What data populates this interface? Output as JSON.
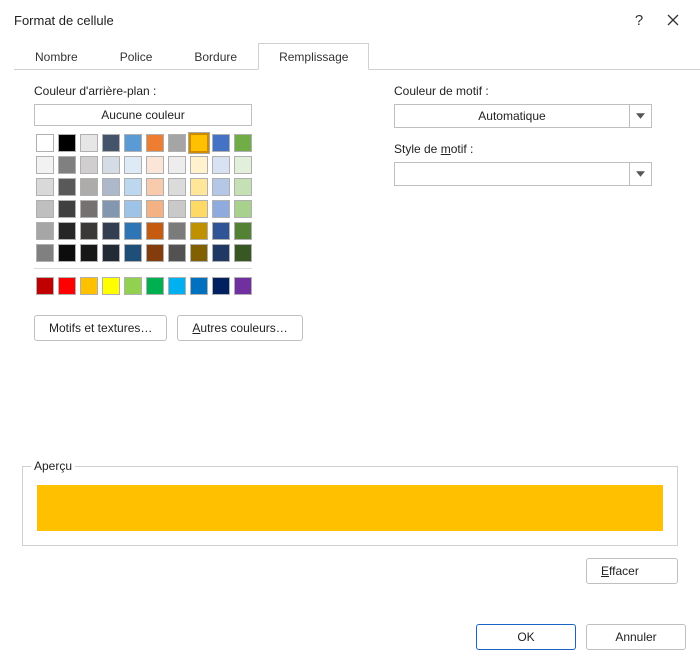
{
  "window": {
    "title": "Format de cellule"
  },
  "tabs": [
    {
      "label": "Nombre",
      "active": false
    },
    {
      "label": "Police",
      "active": false
    },
    {
      "label": "Bordure",
      "active": false
    },
    {
      "label": "Remplissage",
      "active": true
    }
  ],
  "left": {
    "bg_label": "Couleur d'arrière-plan :",
    "no_color": "Aucune couleur",
    "theme_row1": [
      "#FFFFFF",
      "#000000",
      "#E7E6E6",
      "#44546A",
      "#5B9BD5",
      "#ED7D31",
      "#A5A5A5",
      "#FFC000",
      "#4472C4",
      "#70AD47"
    ],
    "theme_selected_index": 7,
    "theme_shades": [
      [
        "#F2F2F2",
        "#808080",
        "#D0CECE",
        "#D6DCE5",
        "#DEEBF7",
        "#FBE5D6",
        "#EDEDED",
        "#FFF2CC",
        "#D9E2F3",
        "#E2EFDA"
      ],
      [
        "#D9D9D9",
        "#595959",
        "#AEABAB",
        "#ADB9CA",
        "#BDD7EE",
        "#F8CBAD",
        "#DBDBDB",
        "#FFE699",
        "#B4C7E7",
        "#C5E0B4"
      ],
      [
        "#BFBFBF",
        "#404040",
        "#767171",
        "#8497B0",
        "#9DC3E6",
        "#F4B183",
        "#C9C9C9",
        "#FFD966",
        "#8FAADC",
        "#A9D18E"
      ],
      [
        "#A6A6A6",
        "#262626",
        "#3B3838",
        "#333F50",
        "#2E75B6",
        "#C55A11",
        "#7B7B7B",
        "#BF9000",
        "#2F5597",
        "#548235"
      ],
      [
        "#808080",
        "#0D0D0D",
        "#171717",
        "#222A35",
        "#1F4E79",
        "#843C0C",
        "#525252",
        "#806000",
        "#203864",
        "#385723"
      ]
    ],
    "standard_colors": [
      "#C00000",
      "#FF0000",
      "#FFC000",
      "#FFFF00",
      "#92D050",
      "#00B050",
      "#00B0F0",
      "#0070C0",
      "#002060",
      "#7030A0"
    ],
    "fill_effects": "Motifs et textures…",
    "more_colors_prefix": "A",
    "more_colors_rest": "utres couleurs…"
  },
  "right": {
    "pattern_color_label": "Couleur de motif :",
    "pattern_color_value": "Automatique",
    "pattern_style_label_prefix": "Style de ",
    "pattern_style_label_u": "m",
    "pattern_style_label_rest": "otif :",
    "pattern_style_value": ""
  },
  "preview": {
    "label": "Aperçu",
    "color": "#FFC000"
  },
  "buttons": {
    "clear_u": "E",
    "clear_rest": "ffacer",
    "ok": "OK",
    "cancel": "Annuler"
  }
}
